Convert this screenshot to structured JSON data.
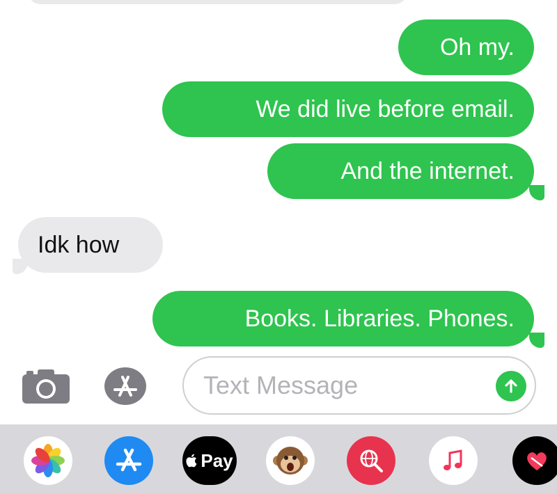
{
  "conversation": {
    "messages": [
      {
        "sender": "me",
        "text": "Oh my."
      },
      {
        "sender": "me",
        "text": "We did live before email."
      },
      {
        "sender": "me",
        "text": "And the internet."
      },
      {
        "sender": "them",
        "text": "Idk how"
      },
      {
        "sender": "me",
        "text": "Books. Libraries. Phones."
      }
    ]
  },
  "input_bar": {
    "placeholder": "Text Message",
    "camera_icon": "camera-icon",
    "apps_icon": "app-store-icon",
    "send_icon": "send-arrow-up-icon"
  },
  "app_drawer": {
    "apps": [
      {
        "name": "photos-app-icon"
      },
      {
        "name": "app-store-app-icon"
      },
      {
        "name": "apple-pay-app-icon",
        "label": "Pay"
      },
      {
        "name": "animoji-monkey-icon"
      },
      {
        "name": "web-search-images-icon"
      },
      {
        "name": "music-app-icon"
      },
      {
        "name": "digital-touch-heart-icon"
      }
    ]
  },
  "colors": {
    "sent_bubble": "#2ec44f",
    "received_bubble": "#e9e9eb",
    "drawer_background": "#d8d8dc"
  }
}
